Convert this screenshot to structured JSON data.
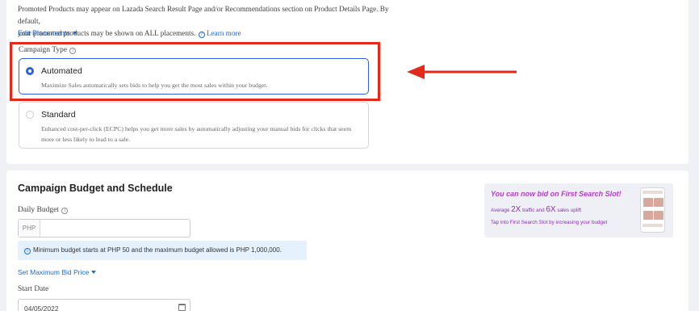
{
  "placements": {
    "line1": "Promoted Products may appear on Lazada Search Result Page and/or Recommendations section on Product Details Page. By default,",
    "line2": "your promoted products may be shown on ALL placements.",
    "learn_more": "Learn more",
    "edit_label": "Edit Placements"
  },
  "campaign_type": {
    "label": "Campaign Type",
    "options": [
      {
        "title": "Automated",
        "description": "Maximize Sales automatically sets bids to help you get the most sales within your budget.",
        "selected": true
      },
      {
        "title": "Standard",
        "description": "Enhanced cost-per-click (ECPC) helps you get more sales by automatically adjusting your manual bids for clicks that seem more or less likely to lead to a sale.",
        "selected": false
      }
    ]
  },
  "budget": {
    "title": "Campaign Budget and Schedule",
    "daily_label": "Daily Budget",
    "currency_prefix": "PHP",
    "daily_value": "",
    "notice": "Minimum budget starts at PHP 50 and the maximum budget allowed is PHP 1,000,000.",
    "max_bid_label": "Set Maximum Bid Price",
    "start_date_label": "Start Date",
    "start_date_value": "04/05/2022"
  },
  "banner": {
    "title": "You can now bid on First Search Slot!",
    "line1_prefix": "Average",
    "line1_num1": "2X",
    "line1_mid": "traffic and",
    "line1_num2": "6X",
    "line1_suffix": "sales uplift",
    "line2": "Tap into First Search Slot by increasing your budget"
  },
  "colors": {
    "accent": "#2d63d6",
    "link": "#1a6dd8",
    "highlight": "#e4291b",
    "banner_title": "#b13bc7"
  },
  "icons": {
    "info": "info-circle-icon",
    "caret": "caret-down-icon",
    "calendar": "calendar-icon",
    "annotation": "arrow-left-icon"
  }
}
